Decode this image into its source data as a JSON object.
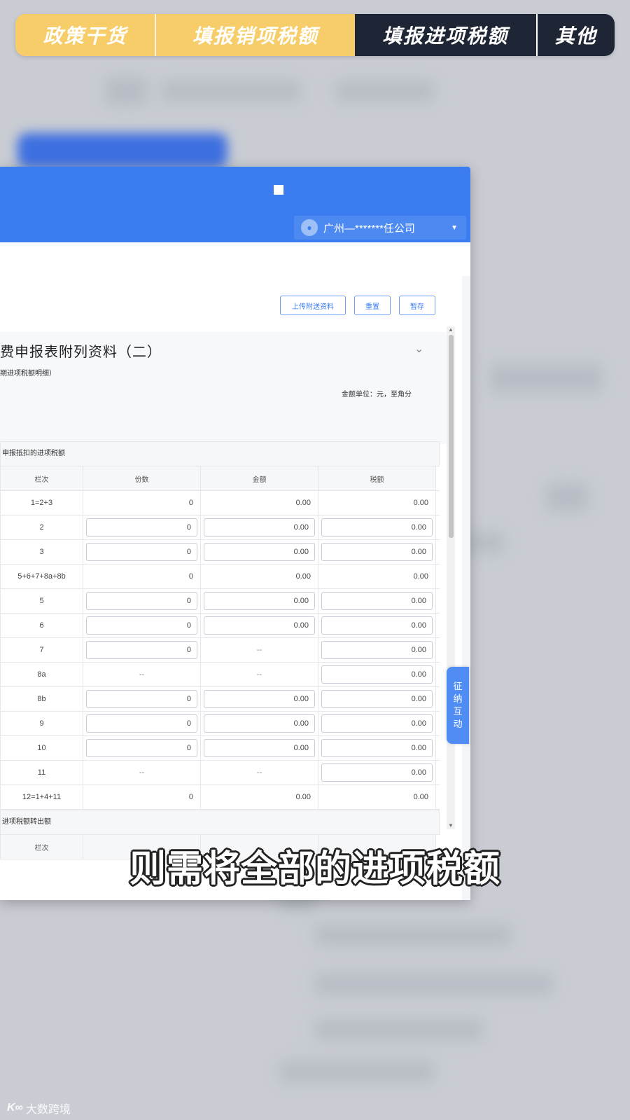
{
  "tabs": [
    {
      "label": "政策干货",
      "active": false
    },
    {
      "label": "填报销项税额",
      "active": false
    },
    {
      "label": "填报进项税额",
      "active": true
    },
    {
      "label": "其他",
      "active": false
    }
  ],
  "header": {
    "company": "广州—*******任公司",
    "avatar_icon": "user-icon"
  },
  "toolbar": {
    "upload_label": "上传附送资料",
    "reset_label": "重置",
    "save_label": "暂存"
  },
  "form": {
    "title": "费申报表附列资料（二）",
    "subtitle": "期进项税额明细）",
    "unit": "金额单位：元，至角分"
  },
  "table": {
    "section_title": "申报抵扣的进项税额",
    "headers": [
      "栏次",
      "份数",
      "金额",
      "税额"
    ],
    "rows": [
      {
        "label": "1=2+3",
        "c1": "0",
        "c2": "0.00",
        "c3": "0.00",
        "e1": false,
        "e2": false,
        "e3": false
      },
      {
        "label": "2",
        "c1": "0",
        "c2": "0.00",
        "c3": "0.00",
        "e1": true,
        "e2": true,
        "e3": true
      },
      {
        "label": "3",
        "c1": "0",
        "c2": "0.00",
        "c3": "0.00",
        "e1": true,
        "e2": true,
        "e3": true
      },
      {
        "label": "5+6+7+8a+8b",
        "c1": "0",
        "c2": "0.00",
        "c3": "0.00",
        "e1": false,
        "e2": false,
        "e3": false
      },
      {
        "label": "5",
        "c1": "0",
        "c2": "0.00",
        "c3": "0.00",
        "e1": true,
        "e2": true,
        "e3": true
      },
      {
        "label": "6",
        "c1": "0",
        "c2": "0.00",
        "c3": "0.00",
        "e1": true,
        "e2": true,
        "e3": true
      },
      {
        "label": "7",
        "c1": "0",
        "c2": "--",
        "c3": "0.00",
        "e1": true,
        "e2": false,
        "e3": true
      },
      {
        "label": "8a",
        "c1": "--",
        "c2": "--",
        "c3": "0.00",
        "e1": false,
        "e2": false,
        "e3": true
      },
      {
        "label": "8b",
        "c1": "0",
        "c2": "0.00",
        "c3": "0.00",
        "e1": true,
        "e2": true,
        "e3": true
      },
      {
        "label": "9",
        "c1": "0",
        "c2": "0.00",
        "c3": "0.00",
        "e1": true,
        "e2": true,
        "e3": true
      },
      {
        "label": "10",
        "c1": "0",
        "c2": "0.00",
        "c3": "0.00",
        "e1": true,
        "e2": true,
        "e3": true
      },
      {
        "label": "11",
        "c1": "--",
        "c2": "--",
        "c3": "0.00",
        "e1": false,
        "e2": false,
        "e3": true
      },
      {
        "label": "12=1+4+11",
        "c1": "0",
        "c2": "0.00",
        "c3": "0.00",
        "e1": false,
        "e2": false,
        "e3": false
      }
    ],
    "next_section": "进项税额转出额",
    "next_header": "栏次"
  },
  "side_tab": {
    "chars": [
      "征",
      "纳",
      "互",
      "动"
    ]
  },
  "caption": "则需将全部的进项税额",
  "watermark": "大数跨境",
  "colors": {
    "primary": "#3b7cf0",
    "tab_light": "#f7cd6a",
    "tab_dark": "#1e2535"
  }
}
